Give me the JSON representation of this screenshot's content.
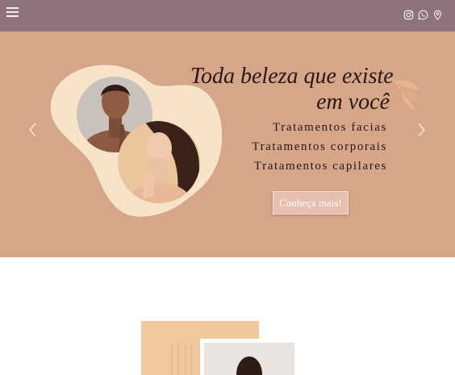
{
  "header": {
    "menu_icon": "hamburger-icon",
    "social_icons": [
      "instagram-icon",
      "whatsapp-icon",
      "location-pin-icon"
    ],
    "bar_color": "#8e737b"
  },
  "hero": {
    "headline_line1": "Toda beleza que existe",
    "headline_line2": "em você",
    "services": [
      "Tratamentos facias",
      "Tratamentos corporais",
      "Tratamentos capilares"
    ],
    "cta_label": "Conheça mais!",
    "background_color": "#d6a689",
    "prev_icon": "chevron-left-icon",
    "next_icon": "chevron-right-icon"
  }
}
